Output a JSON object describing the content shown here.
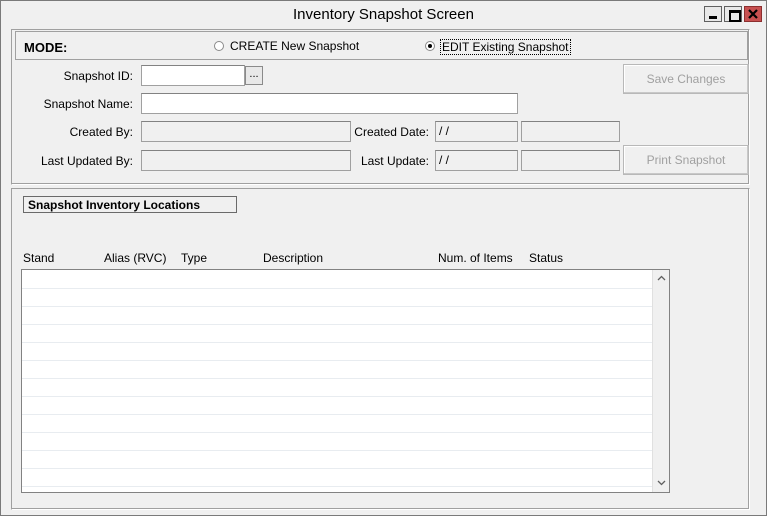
{
  "window": {
    "title": "Inventory Snapshot Screen"
  },
  "mode": {
    "label": "MODE:",
    "options": [
      {
        "label": "CREATE New Snapshot",
        "selected": false
      },
      {
        "label": "EDIT Existing Snapshot",
        "selected": true
      }
    ]
  },
  "form": {
    "snapshot_id_label": "Snapshot ID:",
    "snapshot_id_value": "",
    "browse_label": "...",
    "snapshot_name_label": "Snapshot Name:",
    "snapshot_name_value": "",
    "created_by_label": "Created By:",
    "created_by_value": "",
    "created_date_label": "Created Date:",
    "created_date_value": "/ /",
    "created_time_value": "",
    "last_updated_by_label": "Last Updated By:",
    "last_updated_by_value": "",
    "last_update_label": "Last Update:",
    "last_update_value": "/ /",
    "last_update_time_value": ""
  },
  "buttons": {
    "save_changes": "Save Changes",
    "print_snapshot": "Print Snapshot"
  },
  "locations": {
    "section_title": "Snapshot Inventory Locations",
    "columns": [
      "Stand",
      "Alias (RVC)",
      "Type",
      "Description",
      "Num. of Items",
      "Status"
    ],
    "rows": []
  },
  "icons": {
    "minimize": "minimize-icon",
    "maximize": "maximize-icon",
    "close": "close-icon",
    "scroll_up": "chevron-up-icon",
    "scroll_down": "chevron-down-icon"
  }
}
